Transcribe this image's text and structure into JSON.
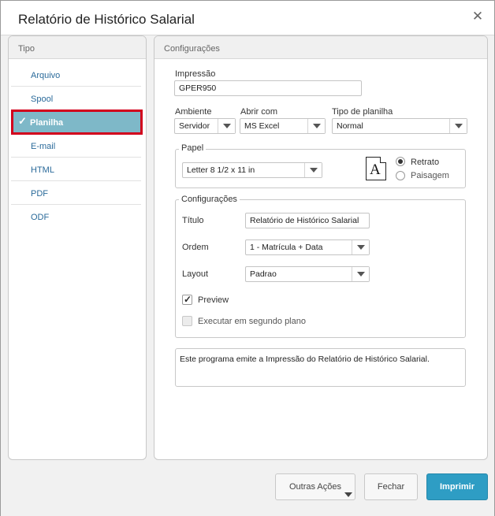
{
  "window": {
    "title": "Relatório de Histórico Salarial"
  },
  "sidebar": {
    "header": "Tipo",
    "items": [
      {
        "label": "Arquivo"
      },
      {
        "label": "Spool"
      },
      {
        "label": "Planilha",
        "selected": true
      },
      {
        "label": "E-mail"
      },
      {
        "label": "HTML"
      },
      {
        "label": "PDF"
      },
      {
        "label": "ODF"
      }
    ]
  },
  "config": {
    "header": "Configurações",
    "impressao": {
      "label": "Impressão",
      "value": "GPER950"
    },
    "ambiente": {
      "label": "Ambiente",
      "value": "Servidor"
    },
    "abrir_com": {
      "label": "Abrir com",
      "value": "MS Excel"
    },
    "tipo_planilha": {
      "label": "Tipo de planilha",
      "value": "Normal"
    },
    "papel": {
      "legend": "Papel",
      "size": "Letter 8 1/2 x 11 in",
      "icon_letter": "A",
      "orientation": [
        {
          "label": "Retrato",
          "selected": true
        },
        {
          "label": "Paisagem",
          "selected": false
        }
      ]
    },
    "section": {
      "legend": "Configurações",
      "titulo": {
        "label": "Título",
        "value": "Relatório de Histórico Salarial"
      },
      "ordem": {
        "label": "Ordem",
        "value": "1 - Matrícula + Data"
      },
      "layout": {
        "label": "Layout",
        "value": "Padrao"
      },
      "preview": {
        "label": "Preview",
        "checked": true
      },
      "segundo_plano": {
        "label": "Executar em segundo plano",
        "checked": false
      }
    },
    "description": "Este programa emite a Impressão do Relatório de Histórico Salarial."
  },
  "footer": {
    "outras_acoes": "Outras Ações",
    "fechar": "Fechar",
    "imprimir": "Imprimir"
  },
  "colors": {
    "accent": "#2e9dc4",
    "selected": "#7eb8c8",
    "highlight": "#d2001c"
  },
  "icons": {
    "close": "close-icon",
    "check": "checkmark-icon",
    "doc": "document-portrait-icon"
  }
}
